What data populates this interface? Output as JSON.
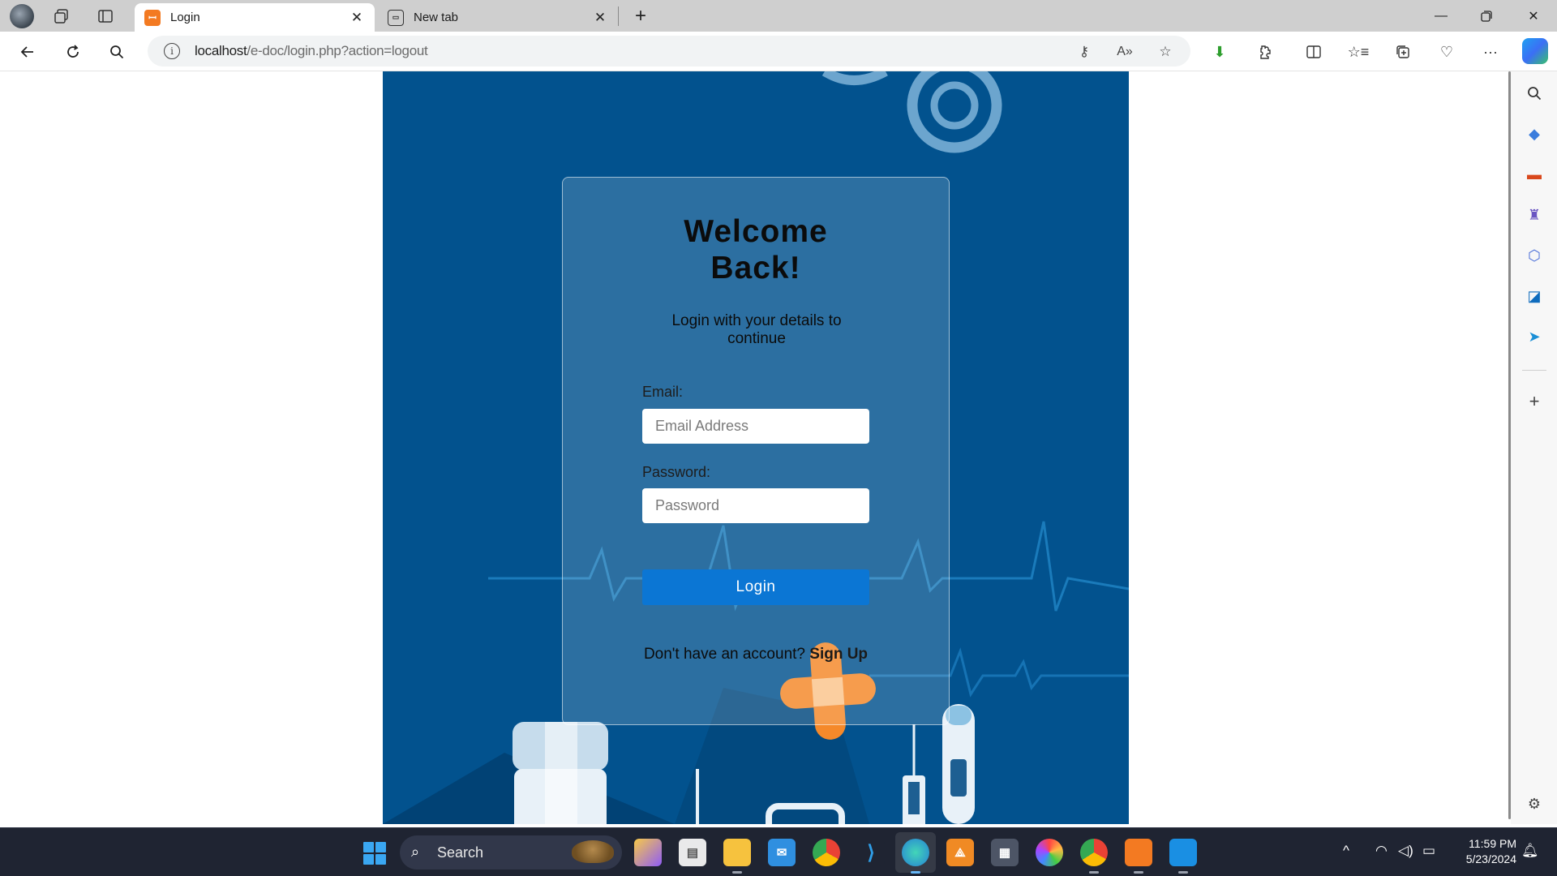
{
  "browser": {
    "tabs": [
      {
        "label": "Login",
        "active": true
      },
      {
        "label": "New tab",
        "active": false
      }
    ],
    "address": {
      "host": "localhost",
      "path": "/e-doc/login.php?action=logout"
    },
    "accent_color": "#0b76d4"
  },
  "page": {
    "background_color": "#02528e",
    "login_card": {
      "title_line1": "Welcome",
      "title_line2": "Back!",
      "subtitle": "Login with your details to continue",
      "email_label": "Email:",
      "email_placeholder": "Email Address",
      "email_value": "",
      "password_label": "Password:",
      "password_placeholder": "Password",
      "password_value": "",
      "login_button": "Login",
      "signup_prompt": "Don't have an account?",
      "signup_link": "Sign Up"
    }
  },
  "taskbar": {
    "search_label": "Search",
    "time": "11:59 PM",
    "date": "5/23/2024"
  }
}
